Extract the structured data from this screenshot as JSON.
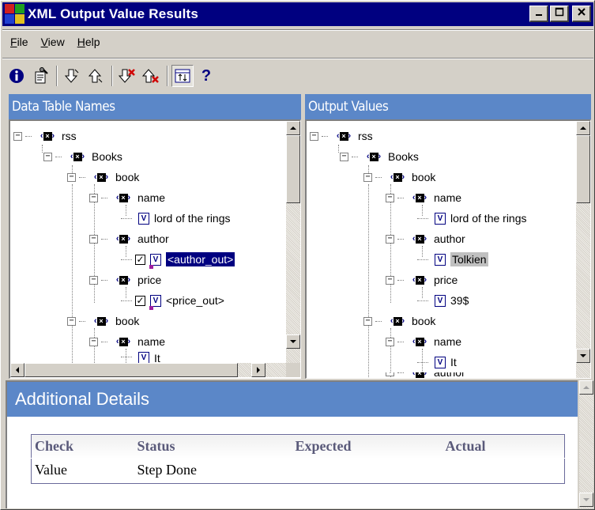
{
  "window": {
    "title": "XML Output Value Results"
  },
  "menu": [
    {
      "label": "File",
      "ul": "F",
      "rest": "ile"
    },
    {
      "label": "View",
      "ul": "V",
      "rest": "iew"
    },
    {
      "label": "Help",
      "ul": "H",
      "rest": "elp"
    }
  ],
  "toolbar": {
    "icons": [
      "info-icon",
      "properties-icon",
      "next-down-icon",
      "previous-up-icon",
      "next-error-icon",
      "previous-error-icon",
      "compare-icon",
      "help-icon"
    ]
  },
  "left_pane": {
    "title": "Data Table Names",
    "nodes": [
      {
        "label": "rss"
      },
      {
        "label": "Books"
      },
      {
        "label": "book"
      },
      {
        "label": "name"
      },
      {
        "label": "lord of the rings"
      },
      {
        "label": "author"
      },
      {
        "label": "<author_out>"
      },
      {
        "label": "price"
      },
      {
        "label": "<price_out>"
      },
      {
        "label": "book"
      },
      {
        "label": "name"
      },
      {
        "label": "It"
      }
    ]
  },
  "right_pane": {
    "title": "Output Values",
    "nodes": [
      {
        "label": "rss"
      },
      {
        "label": "Books"
      },
      {
        "label": "book"
      },
      {
        "label": "name"
      },
      {
        "label": "lord of the rings"
      },
      {
        "label": "author"
      },
      {
        "label": "Tolkien"
      },
      {
        "label": "price"
      },
      {
        "label": "39$"
      },
      {
        "label": "book"
      },
      {
        "label": "name"
      },
      {
        "label": "It"
      },
      {
        "label": "author"
      }
    ]
  },
  "details": {
    "title": "Additional Details",
    "columns": [
      "Check",
      "Status",
      "Expected",
      "Actual"
    ],
    "rows": [
      [
        "Value",
        "Step Done",
        "",
        ""
      ]
    ]
  },
  "colors": {
    "title_bar": "#000080",
    "pane_header": "#5b87c8",
    "selection": "#000080"
  }
}
